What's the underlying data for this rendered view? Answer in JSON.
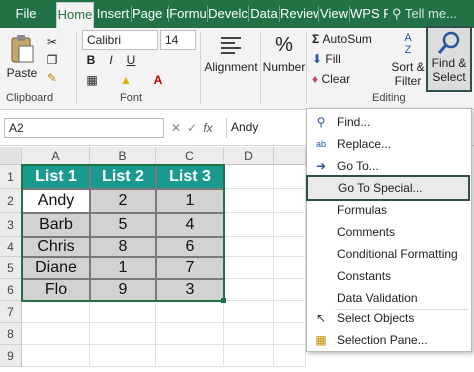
{
  "tabs": [
    "File",
    "Home",
    "Insert",
    "Page L",
    "Formu",
    "Develc",
    "Data",
    "Review",
    "View",
    "WPS P"
  ],
  "tell_me": "Tell me...",
  "ribbon": {
    "paste_label": "Paste",
    "clipboard_label": "Clipboard",
    "font_name": "Calibri",
    "font_size": "14",
    "font_label": "Font",
    "alignment_label": "Alignment",
    "number_label": "Number",
    "percent_symbol": "%",
    "autosum_label": "AutoSum",
    "fill_label": "Fill",
    "clear_label": "Clear",
    "sortfilter_label_1": "Sort &",
    "sortfilter_label_2": "Filter",
    "findselect_label_1": "Find &",
    "findselect_label_2": "Select",
    "editing_label": "Editing",
    "bold": "B",
    "italic": "I",
    "underline": "U"
  },
  "formula_bar": {
    "name_box": "A2",
    "fx": "fx",
    "value": "Andy"
  },
  "columns": [
    "A",
    "B",
    "C",
    "D"
  ],
  "rows": [
    "1",
    "2",
    "3",
    "4",
    "5",
    "6",
    "7",
    "8",
    "9"
  ],
  "table": {
    "headers": [
      "List 1",
      "List 2",
      "List 3"
    ],
    "rows": [
      [
        "Andy",
        "2",
        "1"
      ],
      [
        "Barb",
        "5",
        "4"
      ],
      [
        "Chris",
        "8",
        "6"
      ],
      [
        "Diane",
        "1",
        "7"
      ],
      [
        "Flo",
        "9",
        "3"
      ]
    ]
  },
  "menu": {
    "items": [
      {
        "label": "Find...",
        "icon": "search-icon"
      },
      {
        "label": "Replace...",
        "icon": "replace-icon"
      },
      {
        "label": "Go To...",
        "icon": "arrow-right-icon"
      },
      {
        "label": "Go To Special...",
        "icon": ""
      },
      {
        "label": "Formulas",
        "icon": ""
      },
      {
        "label": "Comments",
        "icon": ""
      },
      {
        "label": "Conditional Formatting",
        "icon": ""
      },
      {
        "label": "Constants",
        "icon": ""
      },
      {
        "label": "Data Validation",
        "icon": ""
      },
      {
        "label": "Select Objects",
        "icon": "cursor-icon"
      },
      {
        "label": "Selection Pane...",
        "icon": "selection-pane-icon"
      }
    ]
  },
  "colors": {
    "tab_bar": "#217346",
    "table_header": "#1a9a8e",
    "table_body": "#d2d2d2",
    "highlight_outline": "#2f4f4f"
  }
}
